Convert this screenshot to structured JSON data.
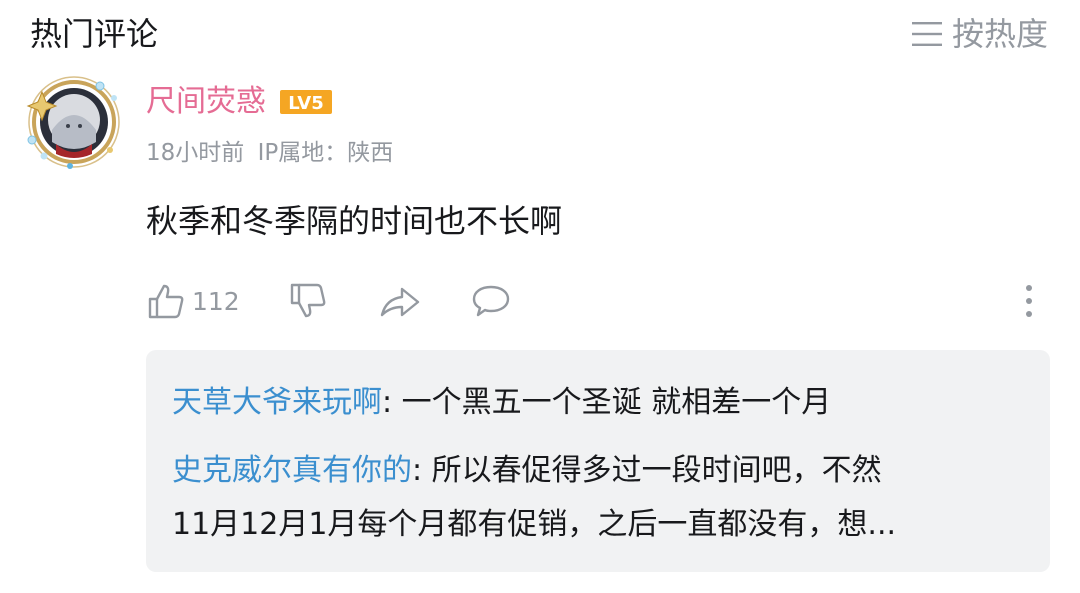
{
  "header": {
    "title": "热门评论",
    "sort_label": "按热度",
    "sort_icon": "menu-lines-icon"
  },
  "comment": {
    "username": "尺间荧惑",
    "level": "LV5",
    "time": "18小时前",
    "ip_location": "IP属地：陕西",
    "text": "秋季和冬季隔的时间也不长啊",
    "like_count": "112",
    "icons": [
      "thumbs-up-icon",
      "thumbs-down-icon",
      "share-icon",
      "reply-icon",
      "more-vertical-icon"
    ]
  },
  "replies": [
    {
      "user": "天草大爷来玩啊",
      "separator": ": ",
      "text": "一个黑五一个圣诞 就相差一个月"
    },
    {
      "user": "史克威尔真有你的",
      "separator": ": ",
      "text": "所以春促得多过一段时间吧，不然",
      "text_cont": "11月12月1月每个月都有促销，之后一直都没有，想..."
    }
  ],
  "colors": {
    "username": "#e56c94",
    "reply_user": "#3b8fcf",
    "muted": "#9499a0",
    "level_badge": "#f5a623",
    "reply_bg": "#f1f2f3"
  }
}
